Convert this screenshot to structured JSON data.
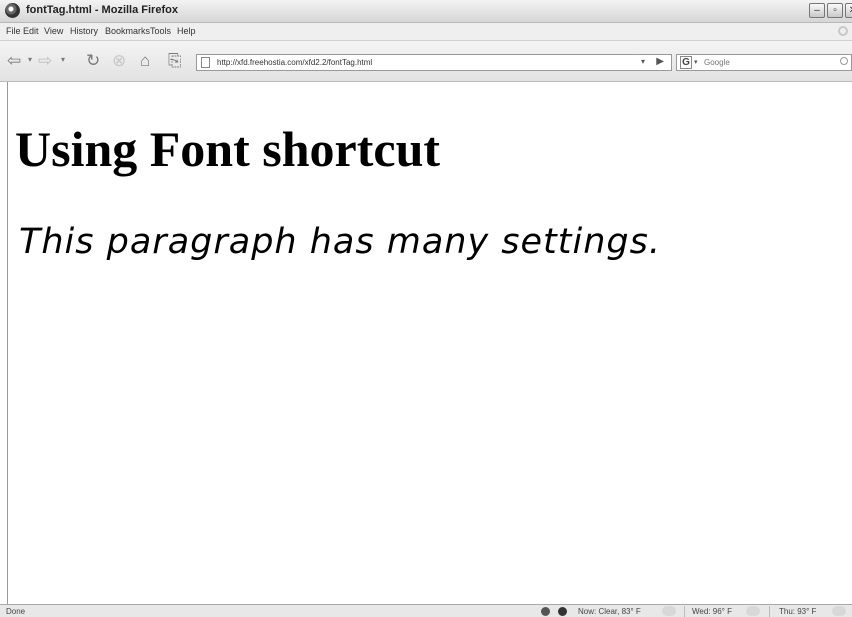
{
  "window": {
    "title": "fontTag.html - Mozilla Firefox",
    "minimize": "–",
    "restore": "▫",
    "close": "✕"
  },
  "menu": [
    "File",
    "Edit",
    "View",
    "History",
    "Bookmarks",
    "Tools",
    "Help"
  ],
  "nav": {
    "url": "http://xfd.freehostia.com/xfd2.2/fontTag.html",
    "search_placeholder": "Google",
    "search_engine": "G"
  },
  "page": {
    "heading": "Using Font shortcut",
    "paragraph": "This paragraph has many settings."
  },
  "status": {
    "text": "Done",
    "weather_now": "Now: Clear, 83° F",
    "weather_wed": "Wed: 96° F",
    "weather_thu": "Thu: 93° F"
  }
}
